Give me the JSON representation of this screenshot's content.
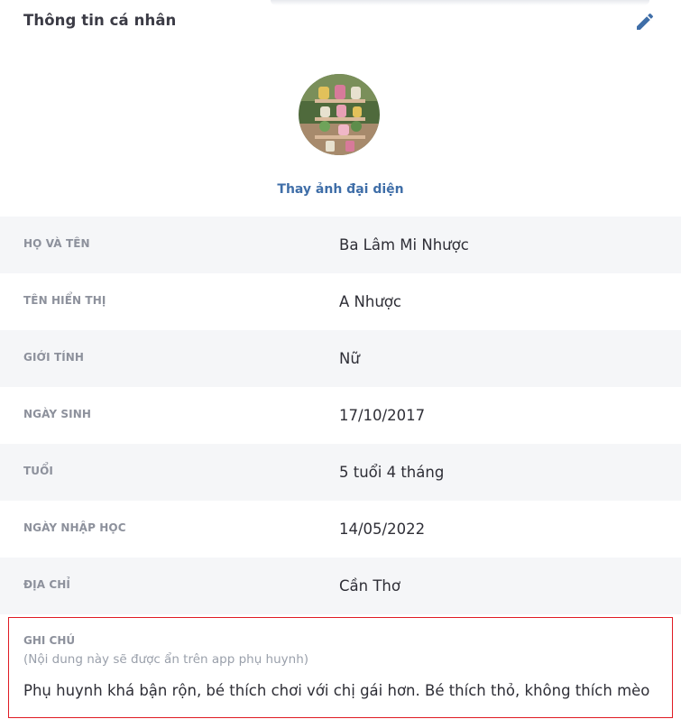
{
  "header": {
    "title": "Thông tin cá nhân",
    "edit_icon": "pencil-icon"
  },
  "avatar": {
    "change_label": "Thay ảnh đại diện"
  },
  "fields": [
    {
      "label": "HỌ VÀ TÊN",
      "value": "Ba Lâm Mi Nhược"
    },
    {
      "label": "TÊN HIỂN THỊ",
      "value": "A Nhược"
    },
    {
      "label": "GIỚI TÍNH",
      "value": "Nữ"
    },
    {
      "label": "NGÀY SINH",
      "value": "17/10/2017"
    },
    {
      "label": "TUỔI",
      "value": "5 tuổi 4 tháng"
    },
    {
      "label": "NGÀY NHẬP HỌC",
      "value": "14/05/2022"
    },
    {
      "label": "ĐỊA CHỈ",
      "value": "Cần Thơ"
    }
  ],
  "note": {
    "label": "GHI CHÚ",
    "hint": "(Nội dung này sẽ được ẩn trên app phụ huynh)",
    "text": "Phụ huynh khá bận rộn, bé thích chơi với chị gái hơn. Bé thích thỏ, không thích mèo"
  },
  "colors": {
    "accent": "#3f6ea8",
    "highlight_border": "#e01b24",
    "row_alt": "#f5f6f8",
    "label": "#8d919c"
  }
}
